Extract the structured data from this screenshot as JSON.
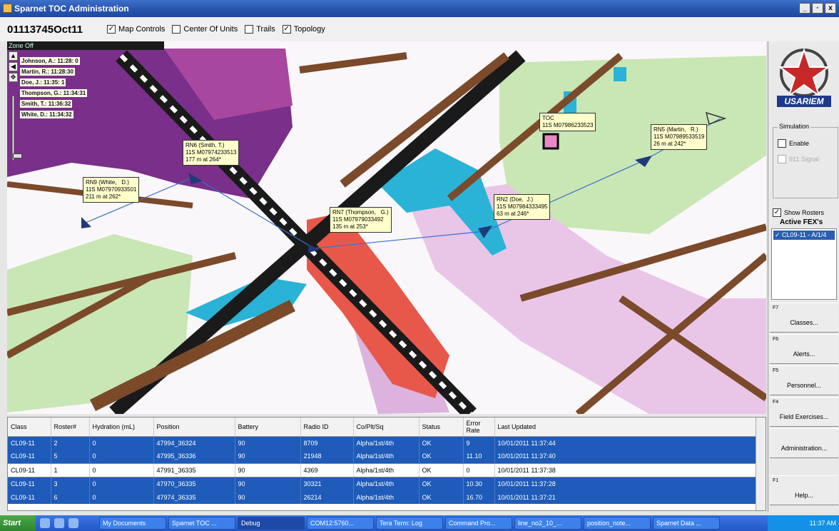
{
  "window": {
    "title": "Sparnet TOC Administration",
    "buttons": [
      "_",
      "·",
      "x"
    ]
  },
  "toolbar": {
    "unit_id": "01113745Oct11",
    "checkboxes": [
      {
        "label": "Map Controls",
        "checked": true
      },
      {
        "label": "Center Of Units",
        "checked": false
      },
      {
        "label": "Trails",
        "checked": false
      },
      {
        "label": "Topology",
        "checked": true
      }
    ]
  },
  "map": {
    "zone_label": "Zone Off",
    "roster_list": [
      "Johnson,  A.: 11:28: 0",
      "Martin,   R.: 11:28:30",
      "Doe,   J.: 11:35: 1",
      "Thompson,   G.: 11:34:31",
      "Smith,  T.: 11:36:32",
      "White,   D.: 11:34:32"
    ],
    "tooltips": {
      "toc": [
        "TOC",
        "11S M07986233523"
      ],
      "rn6": [
        "RN6 (Smith, T.)",
        "11S M07974233513",
        "177 m at 264*"
      ],
      "rn9": [
        "RN9 (White,   D.)",
        "11S M07970933501",
        "211 m at 262*"
      ],
      "rn7": [
        "RN7 (Thompson,   G.)",
        "11S M07979033492",
        "135 m at 253*"
      ],
      "rn2": [
        "RN2 (Doe,  J.)",
        "11S M07984333495",
        "63 m at 246*"
      ],
      "rn5": [
        "RN5 (Martin,   R.)",
        "11S M07989533519",
        "26 m at 242*"
      ]
    }
  },
  "right_panel": {
    "logo_text": "USARIEM",
    "simulation": {
      "legend": "Simulation",
      "enable_label": "Enable",
      "signal_label": "911 Signal"
    },
    "show_rosters_label": "Show Rosters",
    "active_fex_title": "Active FEX's",
    "active_fex_items": [
      "CL09-11 - A/1/4"
    ],
    "buttons": [
      {
        "fkey": "F7",
        "label": "Classes..."
      },
      {
        "fkey": "F6",
        "label": "Alerts..."
      },
      {
        "fkey": "F5",
        "label": "Personnel..."
      },
      {
        "fkey": "F4",
        "label": "Field Exercises..."
      },
      {
        "fkey": "",
        "label": "Administration..."
      },
      {
        "fkey": "F1",
        "label": "Help..."
      }
    ]
  },
  "table": {
    "columns": [
      "Class",
      "Roster#",
      "Hydration (mL)",
      "Position",
      "Battery",
      "Radio ID",
      "Co/Plt/Sq",
      "Status",
      "Error Rate",
      "Last Updated"
    ],
    "rows": [
      {
        "style": "dark",
        "cells": [
          "CL09-11",
          "2",
          "0",
          "47994_36324",
          "90",
          "8709",
          "Alpha/1st/4th",
          "OK",
          "9",
          "10/01/2011 11:37:44"
        ]
      },
      {
        "style": "dark",
        "cells": [
          "CL09-11",
          "5",
          "0",
          "47995_36336",
          "90",
          "21948",
          "Alpha/1st/4th",
          "OK",
          "11.10",
          "10/01/2011 11:37:40"
        ]
      },
      {
        "style": "light",
        "cells": [
          "CL09-11",
          "1",
          "0",
          "47991_36335",
          "90",
          "4369",
          "Alpha/1st/4th",
          "OK",
          "0",
          "10/01/2011 11:37:38"
        ]
      },
      {
        "style": "dark",
        "cells": [
          "CL09-11",
          "3",
          "0",
          "47970_36335",
          "90",
          "30321",
          "Alpha/1st/4th",
          "OK",
          "10.30",
          "10/01/2011 11:37:28"
        ]
      },
      {
        "style": "dark",
        "cells": [
          "CL09-11",
          "6",
          "0",
          "47974_36335",
          "90",
          "26214",
          "Alpha/1st/4th",
          "OK",
          "16.70",
          "10/01/2011 11:37:21"
        ]
      }
    ]
  },
  "taskbar": {
    "start_label": "Start",
    "tasks": [
      {
        "label": "My Documents",
        "active": false
      },
      {
        "label": "Sparnet TOC ...",
        "active": false
      },
      {
        "label": "Debug",
        "active": true
      },
      {
        "label": "COM12:5760...",
        "active": false
      },
      {
        "label": "Tera Term: Log",
        "active": false
      },
      {
        "label": "Command Pro...",
        "active": false
      },
      {
        "label": "line_no2_10_...",
        "active": false
      },
      {
        "label": "position_note...",
        "active": false
      },
      {
        "label": "Sparnet Data ...",
        "active": false
      }
    ],
    "clock": "11:37 AM"
  },
  "colors": {
    "selection_blue": "#1f5bb8",
    "map_purple": "#7a2f8a",
    "map_green": "#c9e6b5",
    "map_red": "#e8584a",
    "map_cyan": "#2ab3d6",
    "map_brown": "#7b4a2a",
    "tooltip_yellow": "#ffffcc"
  }
}
